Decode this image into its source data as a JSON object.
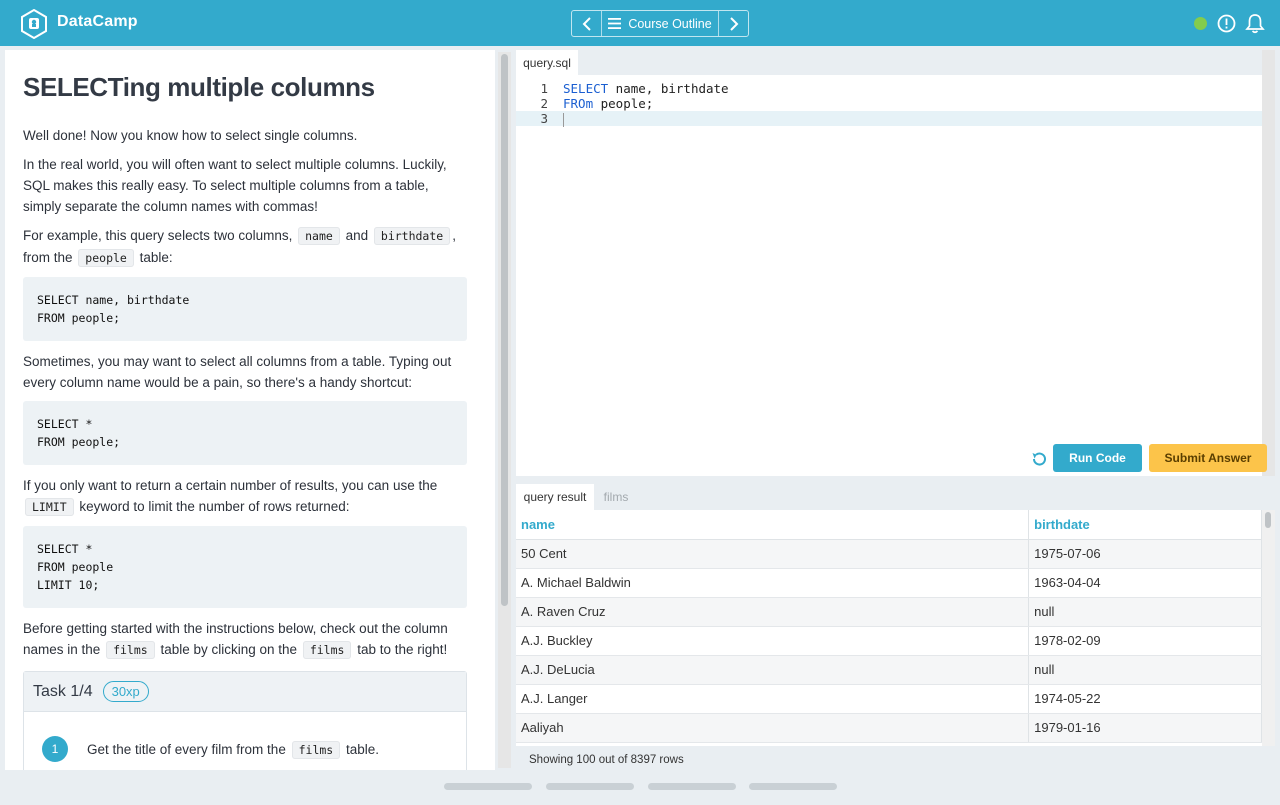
{
  "app": {
    "brand": "DataCamp"
  },
  "topbar": {
    "course_outline_label": "Course Outline",
    "prev_icon": "chevron-left-icon",
    "next_icon": "chevron-right-icon",
    "status_color": "#83cc4d"
  },
  "exercise": {
    "title": "SELECTing multiple columns",
    "p1": "Well done! Now you know how to select single columns.",
    "p2": "In the real world, you will often want to select multiple columns. Luckily, SQL makes this really easy. To select multiple columns from a table, simply separate the column names with commas!",
    "p3_a": "For example, this query selects two columns,",
    "p3_code1": "name",
    "p3_b": "and",
    "p3_code2": "birthdate",
    "p3_c": ", from the",
    "p3_code3": "people",
    "p3_d": "table:",
    "code1": "SELECT name, birthdate\nFROM people;",
    "p4": "Sometimes, you may want to select all columns from a table. Typing out every column name would be a pain, so there's a handy shortcut:",
    "code2": "SELECT *\nFROM people;",
    "p5_a": "If you only want to return a certain number of results, you can use the",
    "p5_code": "LIMIT",
    "p5_b": "keyword to limit the number of rows returned:",
    "code3": "SELECT *\nFROM people\nLIMIT 10;",
    "p6_a": "Before getting started with the instructions below, check out the column names in the",
    "p6_code1": "films",
    "p6_b": "table by clicking on the",
    "p6_code2": "films",
    "p6_c": "tab to the right!"
  },
  "task": {
    "label": "Task 1/4",
    "xp": "30xp",
    "step_number": "1",
    "step_a": "Get the title of every film from the",
    "step_code": "films",
    "step_b": "table."
  },
  "editor": {
    "tab": "query.sql",
    "lines": [
      {
        "num": "1",
        "kw": "SELECT",
        "rest": " name, birthdate"
      },
      {
        "num": "2",
        "kw": "FROm",
        "rest": " people;"
      },
      {
        "num": "3",
        "kw": "",
        "rest": ""
      }
    ]
  },
  "actions": {
    "run": "Run Code",
    "submit": "Submit Answer"
  },
  "results": {
    "tab_active": "query result",
    "tab_inactive": "films",
    "columns": [
      "name",
      "birthdate"
    ],
    "rows": [
      [
        "50 Cent",
        "1975-07-06"
      ],
      [
        "A. Michael Baldwin",
        "1963-04-04"
      ],
      [
        "A. Raven Cruz",
        "null"
      ],
      [
        "A.J. Buckley",
        "1978-02-09"
      ],
      [
        "A.J. DeLucia",
        "null"
      ],
      [
        "A.J. Langer",
        "1974-05-22"
      ],
      [
        "Aaliyah",
        "1979-01-16"
      ]
    ],
    "row_count": "Showing 100 out of 8397 rows"
  }
}
